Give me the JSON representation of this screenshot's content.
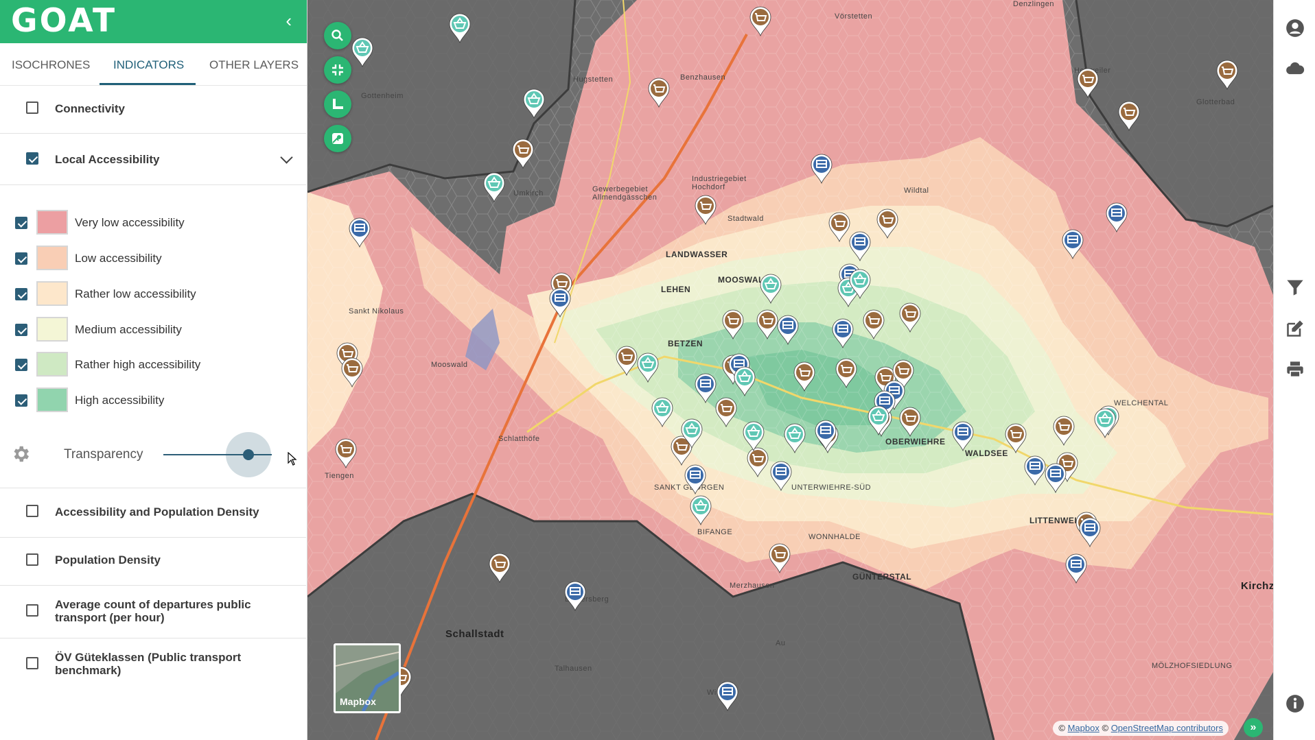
{
  "app": {
    "brand": "GOAT",
    "collapse_icon": "chevron-left-icon"
  },
  "tabs": [
    {
      "label": "ISOCHRONES",
      "active": false
    },
    {
      "label": "INDICATORS",
      "active": true
    },
    {
      "label": "OTHER LAYERS",
      "active": false
    }
  ],
  "layers": {
    "connectivity": {
      "label": "Connectivity",
      "checked": false
    },
    "local_accessibility": {
      "label": "Local Accessibility",
      "checked": true,
      "expanded": true
    },
    "acc_pop_density": {
      "label": "Accessibility and Population Density",
      "checked": false
    },
    "pop_density": {
      "label": "Population Density",
      "checked": false
    },
    "departures": {
      "label": "Average count of departures public transport (per hour)",
      "checked": false
    },
    "ov_gueteklassen": {
      "label": "ÖV Güteklassen (Public transport benchmark)",
      "checked": false
    }
  },
  "legend": [
    {
      "label": "Very low accessibility",
      "color": "#ec9fa2",
      "checked": true
    },
    {
      "label": "Low accessibility",
      "color": "#f9ceb5",
      "checked": true
    },
    {
      "label": "Rather low accessibility",
      "color": "#fde7cb",
      "checked": true
    },
    {
      "label": "Medium accessibility",
      "color": "#f4f6d6",
      "checked": true
    },
    {
      "label": "Rather high accessibility",
      "color": "#cfe9c3",
      "checked": true
    },
    {
      "label": "High accessibility",
      "color": "#91d4ae",
      "checked": true
    }
  ],
  "transparency": {
    "label": "Transparency",
    "value": 0.8
  },
  "map": {
    "place_labels": [
      "Benzhausen",
      "Hugstetten",
      "Gottenheim",
      "Umkirch",
      "Sankt Nikolaus",
      "Mooswald",
      "Schlatthöfe",
      "Tiengen",
      "LANDWASSER",
      "MOOSWALD",
      "LEHEN",
      "BETZEN",
      "Industriegebiet Hochdorf",
      "Gewerbegebiet Allmendgässchen",
      "Stadtwald",
      "Schallstadt",
      "Leutersberg",
      "Talhausen",
      "Merzhausen",
      "GÜNTERSTAL",
      "WONNHALDE",
      "OBERWIEHRE",
      "WALDSEE",
      "LITTENWEILER",
      "WELCHENTAL",
      "UNTERWIEHRE-SÜD",
      "SANKT GEORGEN",
      "BIFANGE",
      "Wildtal",
      "Heuweiler",
      "Glotterbad",
      "Kirchz",
      "MÖLZHOFSIEDLUNG",
      "Au",
      "Wittnau",
      "Vörstetten",
      "Denzlingen"
    ],
    "basemap_label": "Mapbox",
    "attribution": {
      "prefix": "©",
      "mapbox": "Mapbox",
      "sep": "©",
      "osm": "OpenStreetMap contributors"
    },
    "expand_icon": "double-chevron-right-icon"
  },
  "toolbar": [
    "user-icon",
    "cloud-icon",
    "filter-icon",
    "edit-icon",
    "print-icon",
    "info-icon"
  ],
  "colors": {
    "brand": "#2bb673",
    "accent": "#2c5e78",
    "shop_pin": "#9a6b3f",
    "transit_pin": "#3b6aa8",
    "grocery_pin": "#5fc7b4"
  }
}
